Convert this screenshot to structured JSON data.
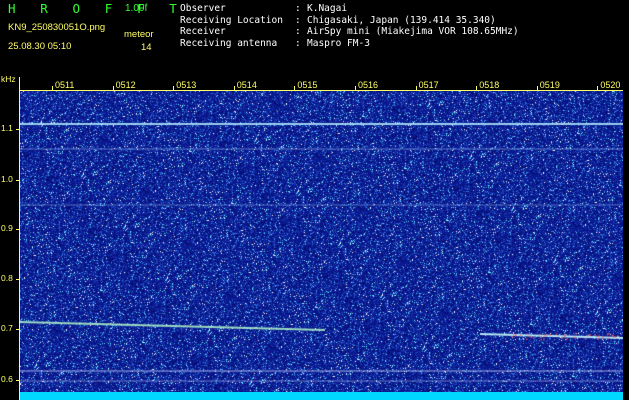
{
  "header": {
    "logo": "HROFFT",
    "version": "1.00f",
    "filename": "KN9_250830051O.png",
    "datetime": "25.08.30 05:10",
    "meteor_label": "meteor",
    "meteor_count": "14"
  },
  "info": [
    {
      "key": "Observer",
      "value": "K.Nagai"
    },
    {
      "key": "Receiving Location",
      "value": "Chigasaki, Japan (139.414 35.340)"
    },
    {
      "key": "Receiver",
      "value": "AirSpy mini (Miakejima VOR 108.65MHz)"
    },
    {
      "key": "Receiving antenna",
      "value": "Maspro FM-3"
    }
  ],
  "axis": {
    "y_unit": "kHz",
    "y_ticks": [
      "1.1",
      "1.0",
      "0.9",
      "0.8",
      "0.7",
      "0.6"
    ],
    "x_ticks": [
      "0511",
      "0512",
      "0513",
      "0514",
      "0515",
      "0516",
      "0517",
      "0518",
      "0519",
      "0520"
    ]
  },
  "colors": {
    "background": "#0b1a92",
    "trace": "#9fe6ff",
    "labels": "#ffff66",
    "logo": "#33ff33"
  }
}
